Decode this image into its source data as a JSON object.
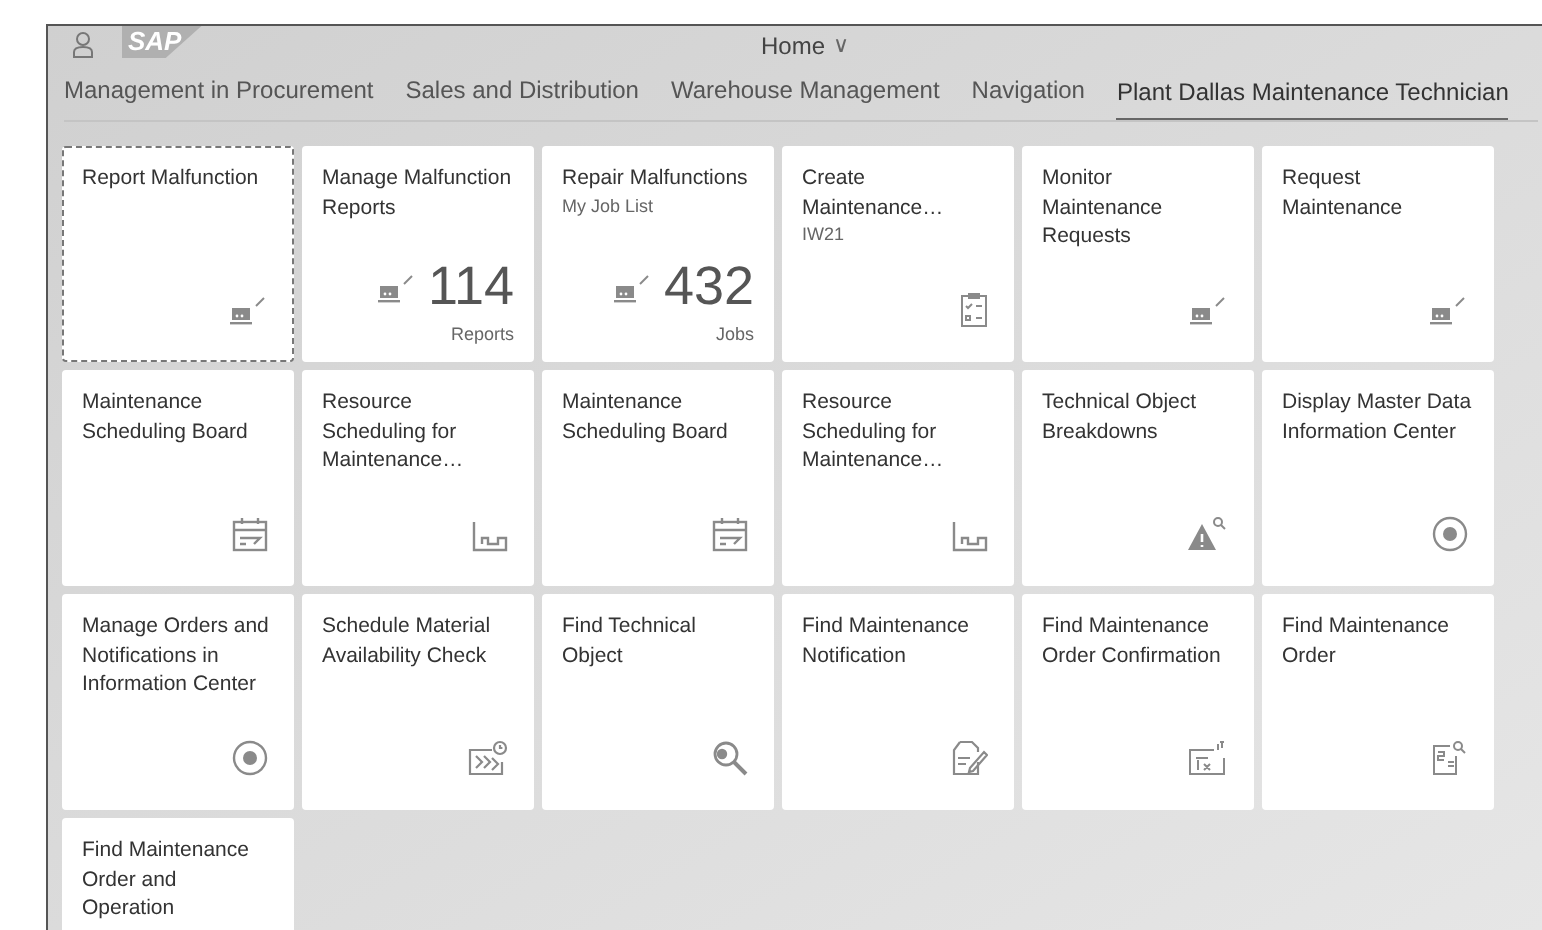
{
  "header": {
    "logo": "SAP",
    "title": "Home",
    "title_caret": "∨"
  },
  "tabs": [
    {
      "label": "Management in Procurement",
      "selected": false
    },
    {
      "label": "Sales and Distribution",
      "selected": false
    },
    {
      "label": "Warehouse Management",
      "selected": false
    },
    {
      "label": "Navigation",
      "selected": false
    },
    {
      "label": "Plant Dallas Maintenance Technician",
      "selected": true
    }
  ],
  "tiles": [
    {
      "title": "Report Malfunction",
      "focused": true
    },
    {
      "title": "Manage Malfunction Reports",
      "number": "114",
      "unit": "Reports",
      "focused": false
    },
    {
      "title": "Repair Malfunctions",
      "subtitle": "My Job List",
      "number": "432",
      "unit": "Jobs",
      "focused": false
    },
    {
      "title": "Create Maintenance…",
      "subtitle": "IW21",
      "focused": false
    },
    {
      "title": "Monitor Maintenance Requests",
      "focused": false
    },
    {
      "title": "Request Maintenance",
      "focused": false
    },
    {
      "title": "Maintenance Scheduling Board",
      "focused": false
    },
    {
      "title": "Resource Scheduling for Maintenance…",
      "focused": false
    },
    {
      "title": "Maintenance Scheduling Board",
      "focused": false
    },
    {
      "title": "Resource Scheduling for Maintenance…",
      "focused": false
    },
    {
      "title": "Technical Object Breakdowns",
      "focused": false
    },
    {
      "title": "Display Master Data Information Center",
      "focused": false
    },
    {
      "title": "Manage Orders and Notifications in Information Center",
      "focused": false
    },
    {
      "title": "Schedule Material Availability Check",
      "focused": false
    },
    {
      "title": "Find Technical Object",
      "focused": false
    },
    {
      "title": "Find Maintenance Notification",
      "focused": false
    },
    {
      "title": "Find Maintenance Order Confirmation",
      "focused": false
    },
    {
      "title": "Find Maintenance Order",
      "focused": false
    },
    {
      "title": "Find Maintenance Order and Operation",
      "focused": false
    }
  ]
}
